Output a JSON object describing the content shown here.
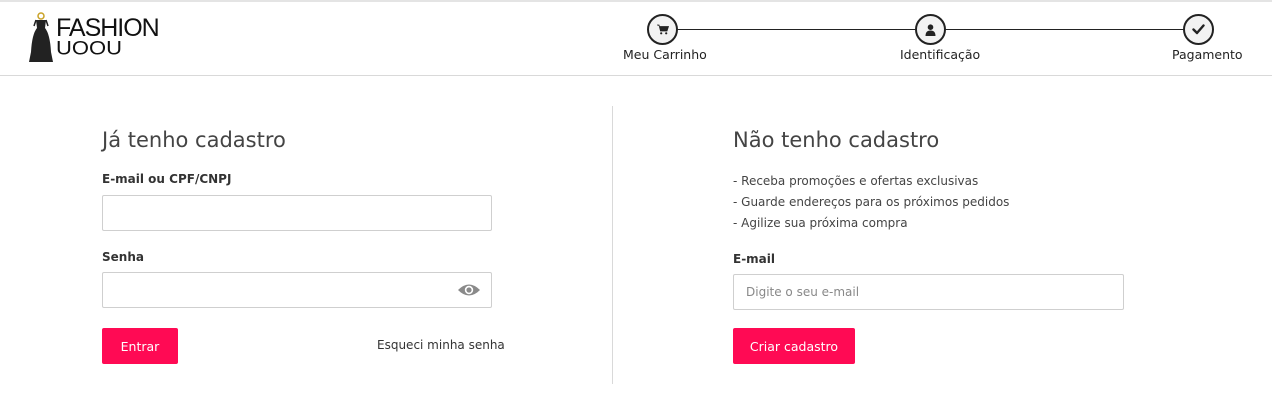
{
  "header": {
    "logo": {
      "line1": "FASHION",
      "line2": "UOOU"
    },
    "steps": [
      {
        "label": "Meu Carrinho",
        "icon": "cart-icon"
      },
      {
        "label": "Identificação",
        "icon": "user-icon"
      },
      {
        "label": "Pagamento",
        "icon": "check-icon"
      }
    ]
  },
  "login": {
    "title": "Já tenho cadastro",
    "email_label": "E-mail ou CPF/CNPJ",
    "email_value": "",
    "password_label": "Senha",
    "password_value": "",
    "submit_label": "Entrar",
    "forgot_label": "Esqueci minha senha"
  },
  "register": {
    "title": "Não tenho cadastro",
    "benefits": [
      "- Receba promoções e ofertas exclusivas",
      "- Guarde endereços para os próximos pedidos",
      "- Agilize sua próxima compra"
    ],
    "email_label": "E-mail",
    "email_placeholder": "Digite o seu e-mail",
    "submit_label": "Criar cadastro"
  },
  "colors": {
    "accent": "#ff0a54",
    "text": "#333333",
    "border": "#d9d9d9"
  }
}
